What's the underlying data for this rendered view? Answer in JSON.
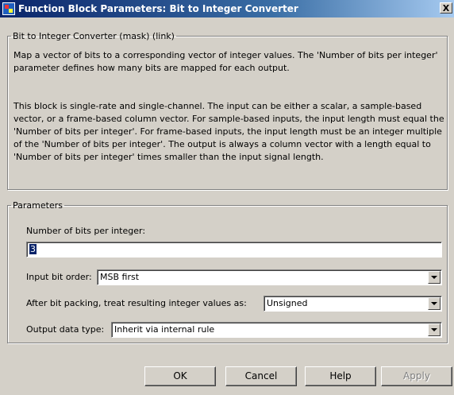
{
  "window": {
    "title": "Function Block Parameters: Bit to Integer Converter",
    "close_label": "X"
  },
  "description": {
    "legend": "Bit to Integer Converter (mask) (link)",
    "paragraph1": "Map a vector of bits to a corresponding vector of integer values. The 'Number of bits per integer' parameter defines how many bits are mapped for each output.",
    "paragraph2": "This block is single-rate and single-channel. The input can be either a scalar, a sample-based vector, or a frame-based column vector. For sample-based inputs, the input length must equal the 'Number of bits per integer'. For frame-based inputs, the input length must be an integer multiple of the 'Number of bits per integer'. The output is always a column vector with a length equal to 'Number of bits per integer' times smaller than the input signal length."
  },
  "parameters": {
    "legend": "Parameters",
    "bits_label": "Number of bits per integer:",
    "bits_value": "3",
    "order_label": "Input bit order:",
    "order_value": "MSB first",
    "treat_label": "After bit packing, treat resulting integer values as:",
    "treat_value": "Unsigned",
    "dtype_label": "Output data type:",
    "dtype_value": "Inherit via internal rule"
  },
  "buttons": {
    "ok": "OK",
    "cancel": "Cancel",
    "help": "Help",
    "apply": "Apply"
  }
}
